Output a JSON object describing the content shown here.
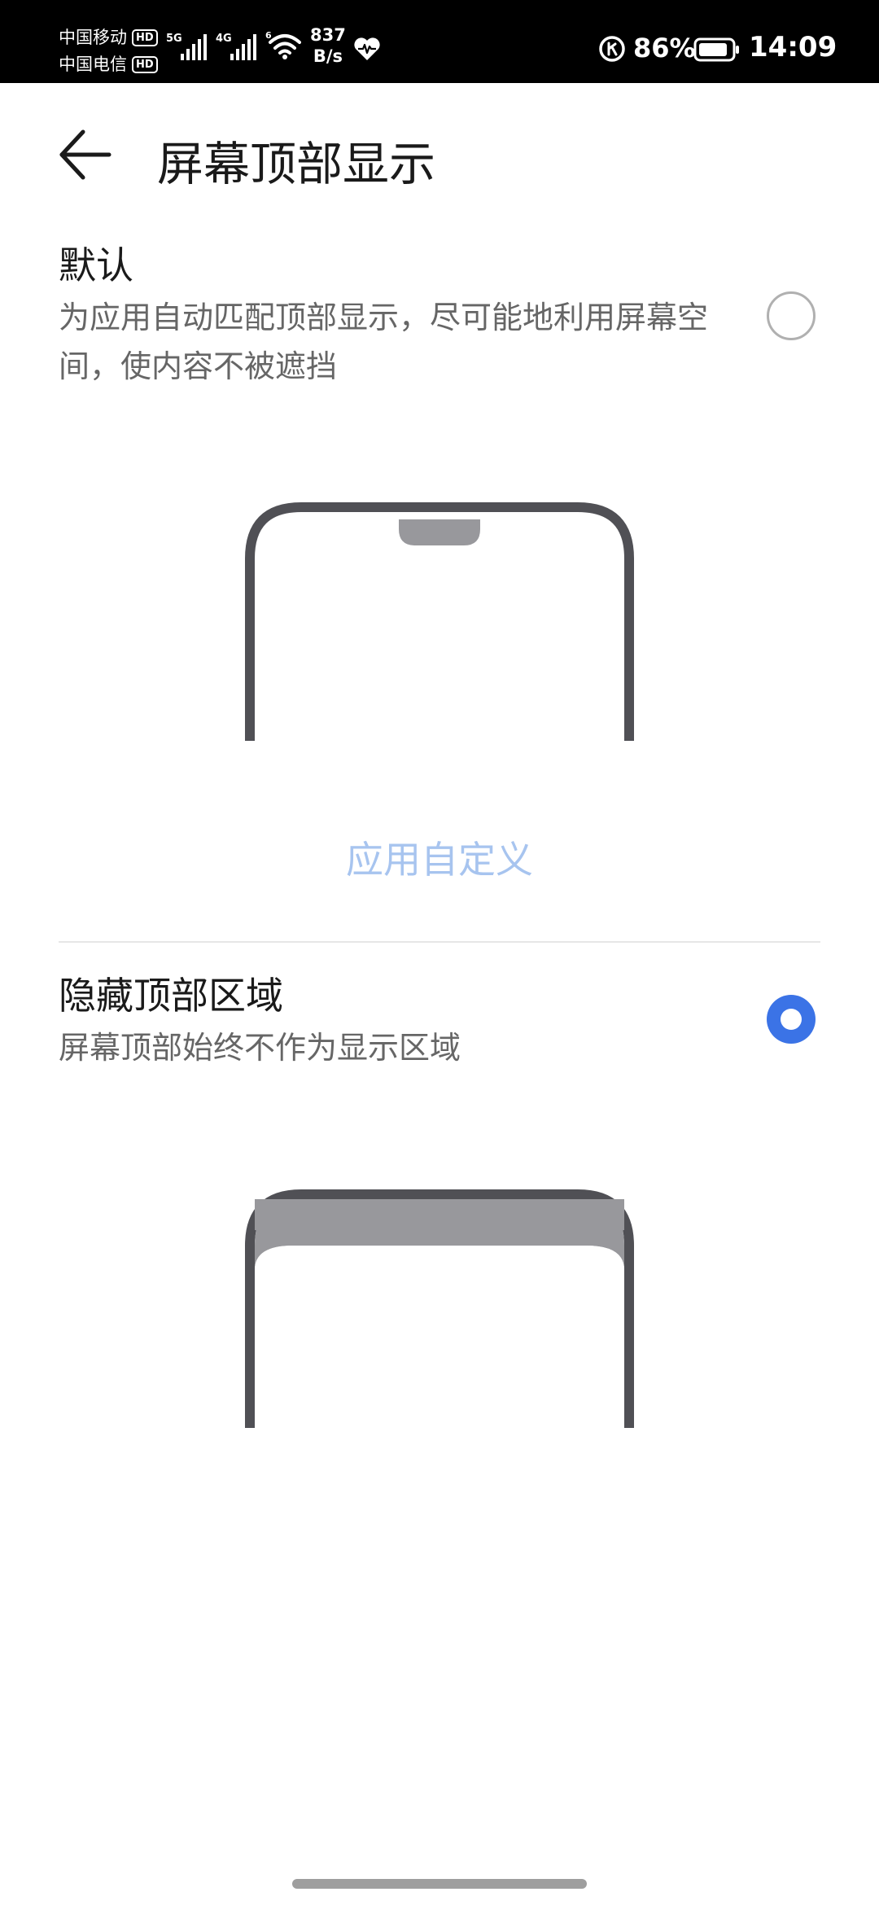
{
  "status_bar": {
    "carrier_1": "中国移动",
    "carrier_2": "中国电信",
    "hd_label": "HD",
    "signal_1_gen": "5G",
    "signal_2_gen": "4G",
    "wifi_gen": "6",
    "net_speed_value": "837",
    "net_speed_unit": "B/s",
    "battery_percent": "86%",
    "time": "14:09",
    "icons": [
      "signal-icon",
      "wifi-icon",
      "heart-icon",
      "hd-call-icon",
      "battery-icon"
    ]
  },
  "header": {
    "back_icon": "back-arrow-icon",
    "title": "屏幕顶部显示"
  },
  "options": [
    {
      "title": "默认",
      "description": "为应用自动匹配顶部显示，尽可能地利用屏幕空间，使内容不被遮挡",
      "selected": false
    },
    {
      "title": "隐藏顶部区域",
      "description": "屏幕顶部始终不作为显示区域",
      "selected": true
    }
  ],
  "app_custom_link": "应用自定义",
  "colors": {
    "accent": "#3b73e6",
    "link_disabled": "#a7c4ef",
    "phone_frame": "#505055",
    "notch_gray": "#98989c"
  }
}
